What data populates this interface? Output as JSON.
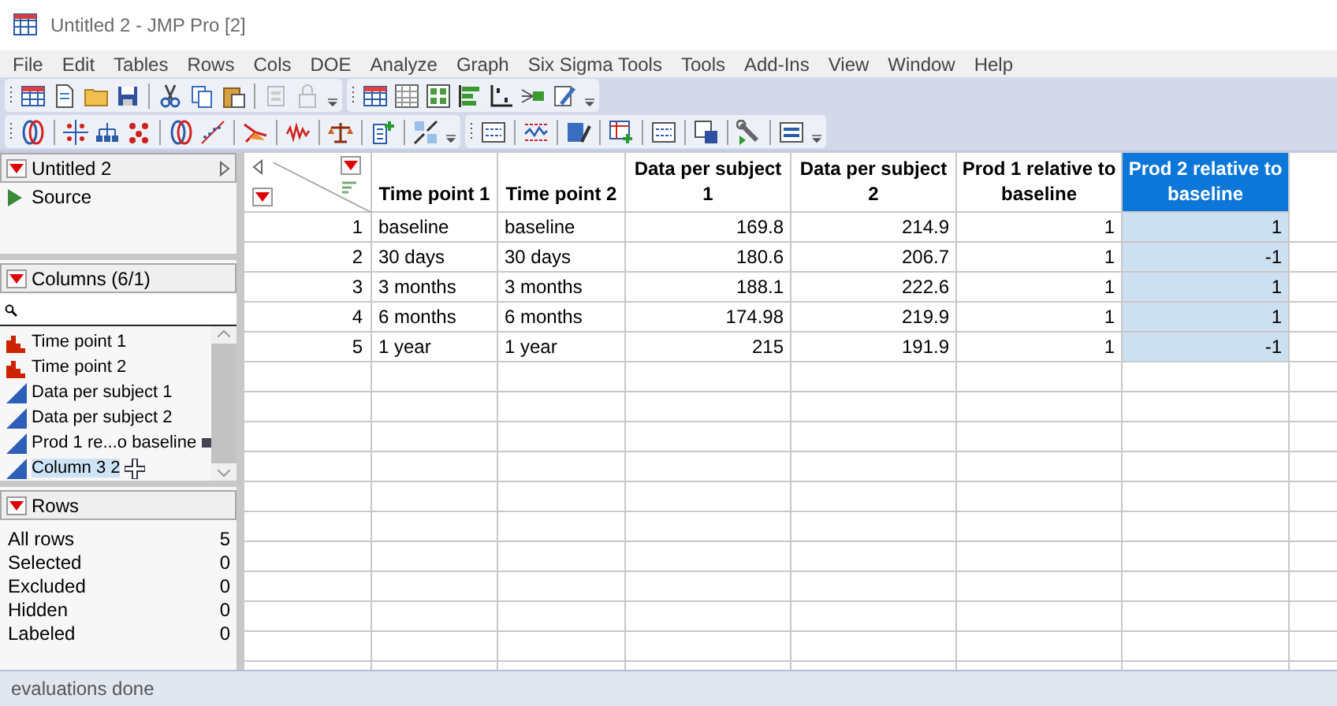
{
  "window": {
    "title": "Untitled 2 - JMP Pro [2]"
  },
  "menu": [
    "File",
    "Edit",
    "Tables",
    "Rows",
    "Cols",
    "DOE",
    "Analyze",
    "Graph",
    "Six Sigma Tools",
    "Tools",
    "Add-Ins",
    "View",
    "Window",
    "Help"
  ],
  "table_panel": {
    "title": "Untitled 2",
    "items": [
      "Source"
    ]
  },
  "columns_panel": {
    "title": "Columns (6/1)",
    "columns": [
      {
        "name": "Time point 1",
        "kind": "nominal",
        "selected": false
      },
      {
        "name": "Time point 2",
        "kind": "nominal",
        "selected": false
      },
      {
        "name": "Data per subject 1",
        "kind": "continuous",
        "selected": false
      },
      {
        "name": "Data per subject 2",
        "kind": "continuous",
        "selected": false
      },
      {
        "name": "Prod 1 re...o baseline",
        "kind": "continuous",
        "selected": false
      },
      {
        "name": "Column 3 2",
        "kind": "continuous",
        "selected": true
      }
    ]
  },
  "rows_panel": {
    "title": "Rows",
    "rows": [
      {
        "label": "All rows",
        "value": "5"
      },
      {
        "label": "Selected",
        "value": "0"
      },
      {
        "label": "Excluded",
        "value": "0"
      },
      {
        "label": "Hidden",
        "value": "0"
      },
      {
        "label": "Labeled",
        "value": "0"
      }
    ]
  },
  "table": {
    "columns": [
      {
        "heading": "Time point 1",
        "kind": "character",
        "selected": false
      },
      {
        "heading": "Time point 2",
        "kind": "character",
        "selected": false
      },
      {
        "heading": "Data per subject 1",
        "kind": "numeric",
        "selected": false
      },
      {
        "heading": "Data per subject 2",
        "kind": "numeric",
        "selected": false
      },
      {
        "heading": "Prod 1 relative to baseline",
        "kind": "numeric",
        "selected": false
      },
      {
        "heading": "Prod 2 relative to baseline",
        "kind": "numeric",
        "selected": true
      }
    ],
    "rows": [
      {
        "number": "1",
        "cells": [
          "baseline",
          "baseline",
          "169.8",
          "214.9",
          "1",
          "1"
        ]
      },
      {
        "number": "2",
        "cells": [
          "30 days",
          "30 days",
          "180.6",
          "206.7",
          "1",
          "-1"
        ]
      },
      {
        "number": "3",
        "cells": [
          "3 months",
          "3 months",
          "188.1",
          "222.6",
          "1",
          "1"
        ]
      },
      {
        "number": "4",
        "cells": [
          "6 months",
          "6 months",
          "174.98",
          "219.9",
          "1",
          "1"
        ]
      },
      {
        "number": "5",
        "cells": [
          "1 year",
          "1 year",
          "215",
          "191.9",
          "1",
          "-1"
        ]
      }
    ]
  },
  "status_bar": "evaluations done"
}
